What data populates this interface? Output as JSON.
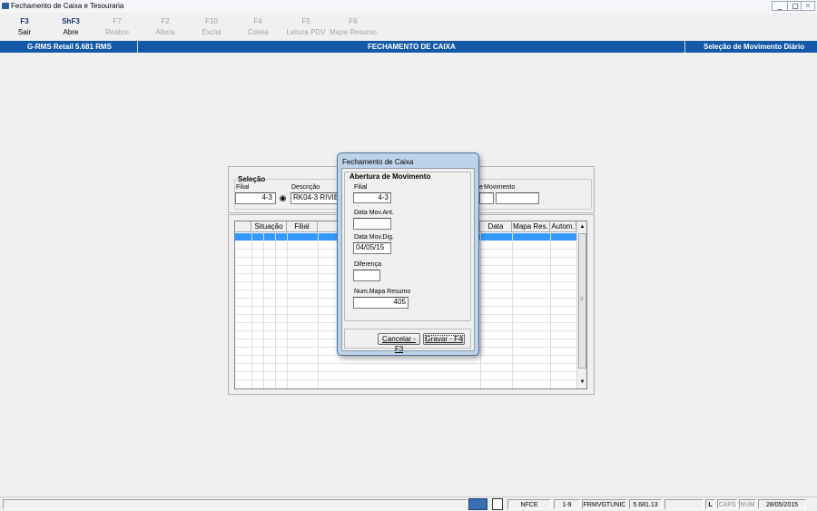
{
  "window": {
    "title": "Fechamento de Caixa e Tesouraria",
    "buttons": {
      "minimize": "_",
      "restore": "▢",
      "close": "✕"
    }
  },
  "toolbar": [
    {
      "key": "F3",
      "label": "Sair",
      "enabled": true
    },
    {
      "key": "ShF3",
      "label": "Abre",
      "enabled": true
    },
    {
      "key": "F7",
      "label": "Reabre",
      "enabled": false
    },
    {
      "key": "F2",
      "label": "Altera",
      "enabled": false
    },
    {
      "key": "F10",
      "label": "Exclui",
      "enabled": false
    },
    {
      "key": "F4",
      "label": "Coleta",
      "enabled": false
    },
    {
      "key": "F5",
      "label": "Leitura PDV",
      "enabled": false
    },
    {
      "key": "F6",
      "label": "Mapa Resumo",
      "enabled": false
    }
  ],
  "header": {
    "left": "G-RMS Retail 5.681 RMS",
    "center": "FECHAMENTO DE CAIXA",
    "right": "Seleção de Movimento Diário"
  },
  "selecao": {
    "title": "Seleção",
    "filial_label": "Filial",
    "filial_value": "4-3",
    "descricao_label": "Descrição",
    "descricao_value": "RK04-3 RIVIERA",
    "movimento_label": "Movimento",
    "movimento_prefix": "e"
  },
  "grid": {
    "columns": [
      "Situação",
      "Filial",
      "Data",
      "Mapa Res.",
      "Autom."
    ]
  },
  "dialog": {
    "title": "Fechamento de Caixa",
    "group_title": "Abertura de Movimento",
    "fields": {
      "filial_label": "Filial",
      "filial_value": "4-3",
      "data_mov_ant_label": "Data Mov.Ant.",
      "data_mov_ant_value": "",
      "data_mov_dig_label": "Data Mov.Dig.",
      "data_mov_dig_value": "04/05/15",
      "diferenca_label": "Diferença",
      "diferenca_value": "",
      "num_mapa_label": "Num.Mapa Resumo",
      "num_mapa_value": "405"
    },
    "cancel_label": "Cancelar - F3",
    "save_label": "Gravar - F4"
  },
  "statusbar": {
    "nfce": "NFCE",
    "pages": "1-9",
    "program": "FRMVGTUNIC",
    "version": "5.681.13",
    "l": "L",
    "caps": "CAPS",
    "num": "NUM",
    "date": "28/05/2015"
  },
  "colors": {
    "accent": "#1459a8",
    "selected_row": "#3399ff",
    "dialog_frame": "#bcd3ea"
  }
}
